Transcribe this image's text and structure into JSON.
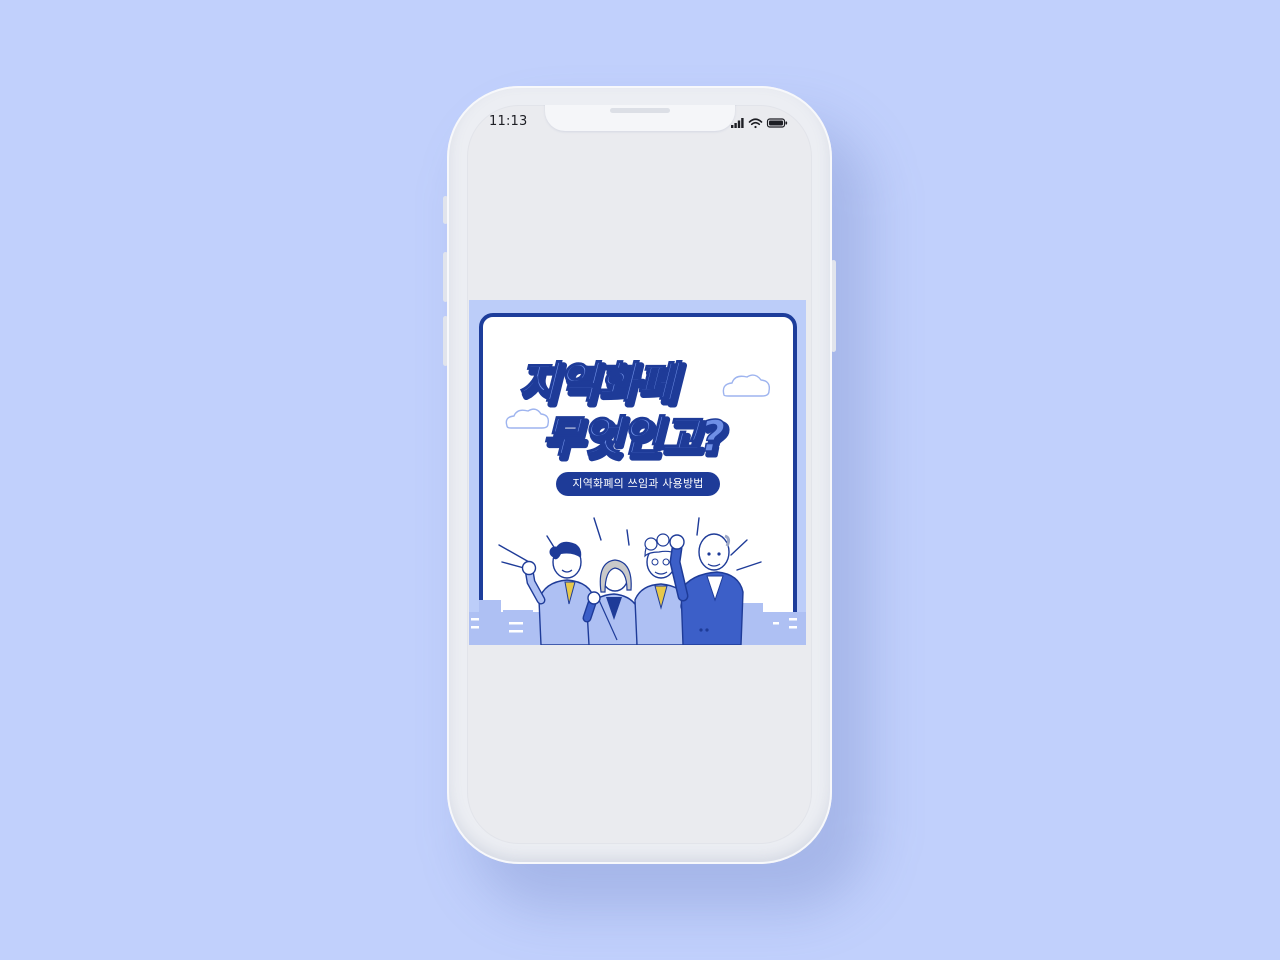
{
  "status_bar": {
    "time": "11:13",
    "icons": [
      "signal-icon",
      "wifi-icon",
      "battery-icon"
    ]
  },
  "banner": {
    "title_line1": "지역화폐",
    "title_line2": "무엇인고?",
    "subtitle": "지역화폐의 쓰임과 사용방법"
  },
  "colors": {
    "background": "#c1d0fc",
    "phone_body": "#eceef3",
    "screen": "#eaebef",
    "banner_accent": "#1e3b98",
    "banner_light": "#bccdf9"
  }
}
